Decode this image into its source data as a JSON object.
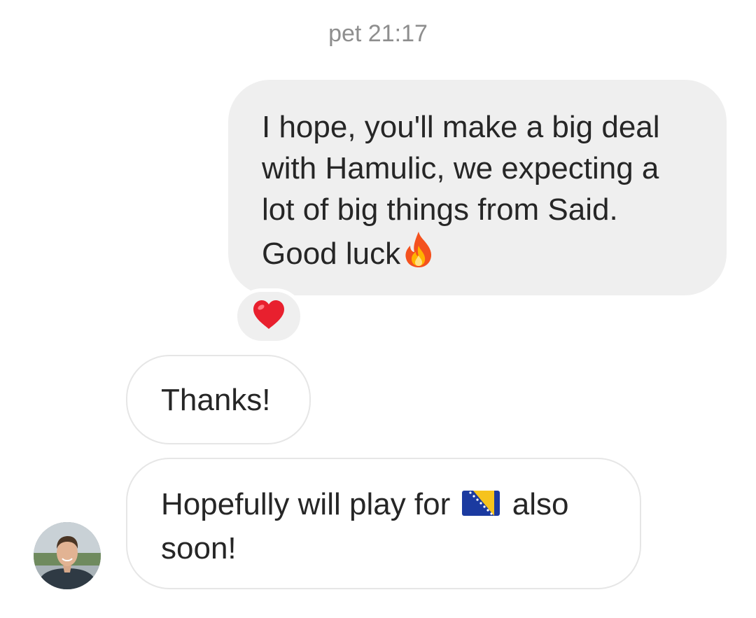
{
  "thread": {
    "timestamp": "pet 21:17"
  },
  "messages": {
    "outgoing": {
      "text": "I hope, you'll make a big deal with Hamulic, we expecting a lot of big things from Said. Good luck",
      "emoji": "fire-icon",
      "reaction": "heart-icon"
    },
    "incoming": [
      {
        "text": "Thanks!"
      },
      {
        "text_before": "Hopefully will play for",
        "flag": "bosnia-flag-icon",
        "text_after": "also soon!"
      }
    ]
  },
  "colors": {
    "outgoing_bubble": "#efefef",
    "incoming_border": "#e6e6e6",
    "text": "#262626",
    "timestamp": "#8e8e8e",
    "heart": "#e8202e",
    "flag_blue": "#1b3aa0",
    "flag_yellow": "#f6c31d"
  }
}
